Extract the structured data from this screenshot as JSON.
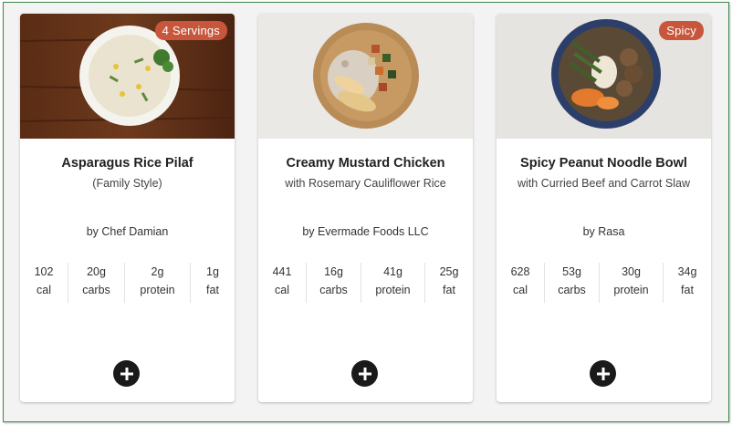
{
  "recipes": [
    {
      "title": "Asparagus Rice Pilaf",
      "subtitle": "(Family Style)",
      "author": "by Chef Damian",
      "badge": "4 Servings",
      "nutrition": {
        "cal": {
          "value": "102",
          "label": "cal"
        },
        "carbs": {
          "value": "20g",
          "label": "carbs"
        },
        "protein": {
          "value": "2g",
          "label": "protein"
        },
        "fat": {
          "value": "1g",
          "label": "fat"
        }
      }
    },
    {
      "title": "Creamy Mustard Chicken",
      "subtitle": "with Rosemary Cauliflower Rice",
      "author": "by Evermade Foods LLC",
      "badge": "",
      "nutrition": {
        "cal": {
          "value": "441",
          "label": "cal"
        },
        "carbs": {
          "value": "16g",
          "label": "carbs"
        },
        "protein": {
          "value": "41g",
          "label": "protein"
        },
        "fat": {
          "value": "25g",
          "label": "fat"
        }
      }
    },
    {
      "title": "Spicy Peanut Noodle Bowl",
      "subtitle": "with Curried Beef and Carrot Slaw",
      "author": "by Rasa",
      "badge": "Spicy",
      "nutrition": {
        "cal": {
          "value": "628",
          "label": "cal"
        },
        "carbs": {
          "value": "53g",
          "label": "carbs"
        },
        "protein": {
          "value": "30g",
          "label": "protein"
        },
        "fat": {
          "value": "34g",
          "label": "fat"
        }
      }
    }
  ],
  "icons": {
    "add": "plus-circle-icon"
  },
  "colors": {
    "badge": "#c8563d",
    "add_button": "#1a1a1a",
    "frame_border": "#3f8a4a"
  }
}
